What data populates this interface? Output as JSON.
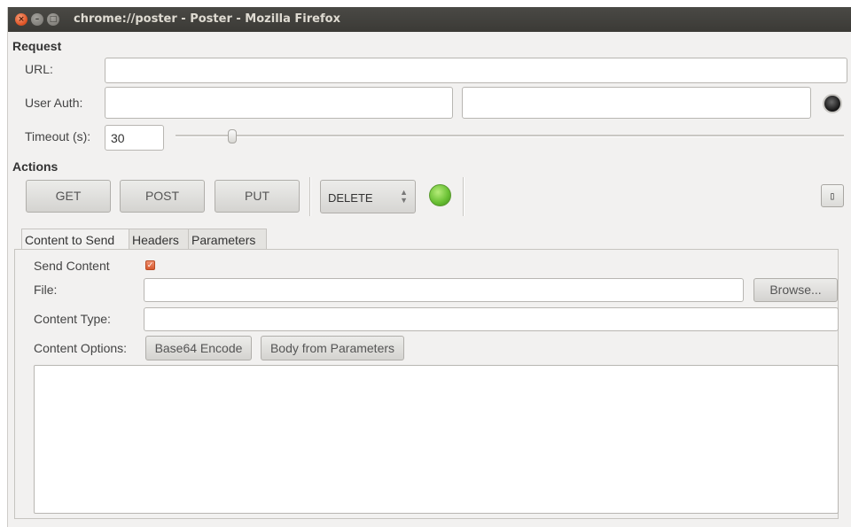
{
  "window": {
    "title": "chrome://poster - Poster - Mozilla Firefox",
    "close_glyph": "×",
    "minimize_glyph": "–",
    "maximize_glyph": "□"
  },
  "request": {
    "heading": "Request",
    "url_label": "URL:",
    "url_value": "",
    "user_auth_label": "User Auth:",
    "user_value": "",
    "password_value": "",
    "timeout_label": "Timeout (s):",
    "timeout_value": "30"
  },
  "actions": {
    "heading": "Actions",
    "get_label": "GET",
    "post_label": "POST",
    "put_label": "PUT",
    "method_select_value": "DELETE",
    "select_arrows_icon": "up-down-arrows-icon",
    "status_color": "#6cc236",
    "settings_icon": "tool-icon",
    "settings_glyph": "▯"
  },
  "tabs": [
    {
      "label": "Content to Send",
      "active": true
    },
    {
      "label": "Headers",
      "active": false
    },
    {
      "label": "Parameters",
      "active": false
    }
  ],
  "content": {
    "send_content_label": "Send Content",
    "send_content_checked": true,
    "check_glyph": "✓",
    "file_label": "File:",
    "file_value": "",
    "browse_label": "Browse...",
    "content_type_label": "Content Type:",
    "content_type_value": "",
    "content_options_label": "Content Options:",
    "base64_label": "Base64 Encode",
    "body_from_params_label": "Body from Parameters",
    "body_value": ""
  }
}
